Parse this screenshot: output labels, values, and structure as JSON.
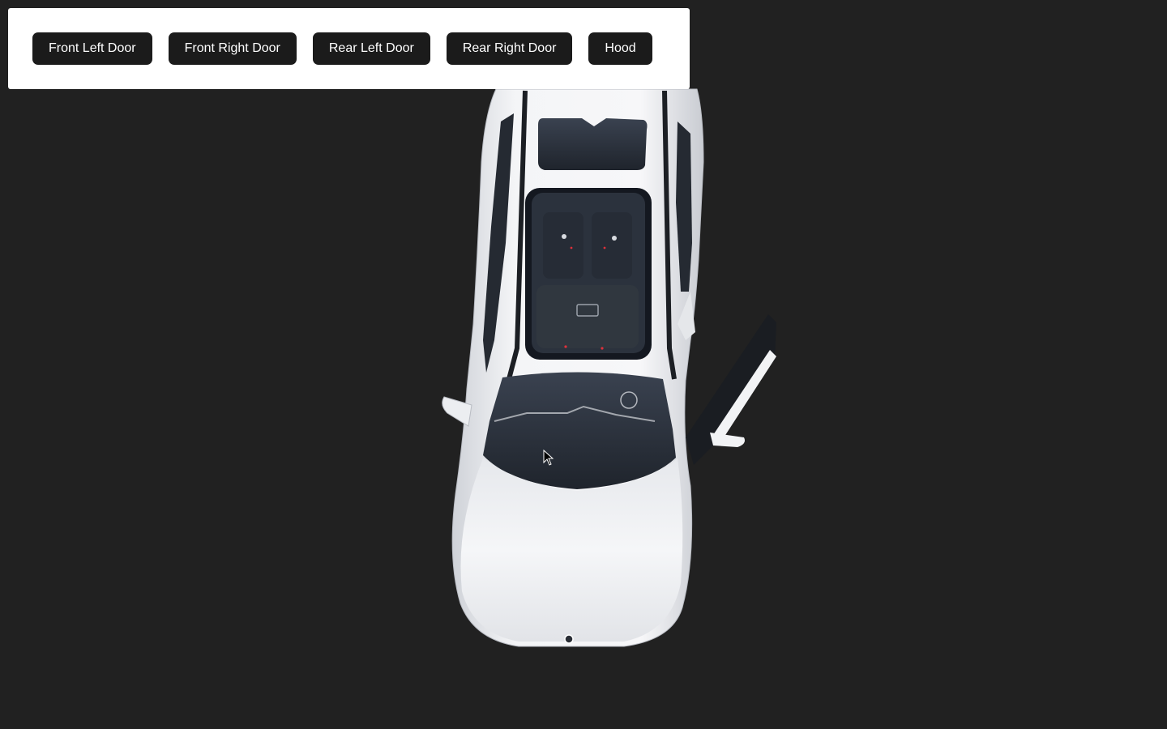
{
  "controls": {
    "buttons": [
      {
        "id": "front-left-door",
        "label": "Front Left Door"
      },
      {
        "id": "front-right-door",
        "label": "Front Right Door"
      },
      {
        "id": "rear-left-door",
        "label": "Rear Left Door"
      },
      {
        "id": "rear-right-door",
        "label": "Rear Right Door"
      },
      {
        "id": "hood",
        "label": "Hood"
      }
    ]
  },
  "scene": {
    "background_color": "#212121",
    "car_color": "#f2f2f4",
    "glass_color": "#2a3240",
    "open_parts": [
      "front-right-door"
    ]
  }
}
